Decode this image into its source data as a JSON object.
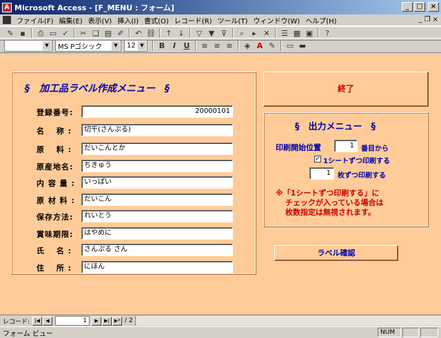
{
  "window": {
    "title": "Microsoft Access - [F_MENU : フォーム]",
    "min": "_",
    "max": "□",
    "close": "×"
  },
  "menu": [
    "ファイル(F)",
    "編集(E)",
    "表示(V)",
    "挿入(I)",
    "書式(O)",
    "レコード(R)",
    "ツール(T)",
    "ウィンドウ(W)",
    "ヘルプ(H)"
  ],
  "toolbar2": {
    "object": "",
    "font": "MS Pゴシック",
    "size": "12",
    "bold": "B",
    "italic": "I",
    "underline": "U"
  },
  "form": {
    "heading": "§　加工品ラベル作成メニュー　§",
    "fields": [
      {
        "label": "登録番号:",
        "value": "20000101",
        "align": "right"
      },
      {
        "label": "名　 称 :",
        "value": "切干(さんぷる)",
        "align": "left"
      },
      {
        "label": "原　 料 :",
        "value": "だいこんとか",
        "align": "left"
      },
      {
        "label": "原産地名:",
        "value": "ちきゅう",
        "align": "left"
      },
      {
        "label": "内 容 量 :",
        "value": "いっぱい",
        "align": "left"
      },
      {
        "label": "原 材 料 :",
        "value": "だいこん",
        "align": "left"
      },
      {
        "label": "保存方法:",
        "value": "れいとう",
        "align": "left"
      },
      {
        "label": "賞味期限:",
        "value": "はやめに",
        "align": "left"
      },
      {
        "label": "氏　 名 :",
        "value": "さんぷる さん",
        "align": "left"
      },
      {
        "label": "住　 所 :",
        "value": "にほん",
        "align": "left"
      }
    ],
    "exit_label": "終了",
    "output": {
      "heading": "§　出力メニュー　§",
      "start_label": "印刷開始位置",
      "start_value": "1",
      "start_suffix": "番目から",
      "check_label": "1シートずつ印刷する",
      "check_mark": "✓",
      "copies_value": "1",
      "copies_suffix": "枚ずつ印刷する",
      "note": [
        "※「1シートずつ印刷する」に",
        "チェックが入っている場合は",
        "枚数指定は無視されます。"
      ]
    },
    "label_button": "ラベル確認"
  },
  "nav": {
    "label": "レコード:",
    "current": "1",
    "total": "/ 2"
  },
  "status": {
    "text": "フォーム ビュー",
    "num": "NUM"
  }
}
